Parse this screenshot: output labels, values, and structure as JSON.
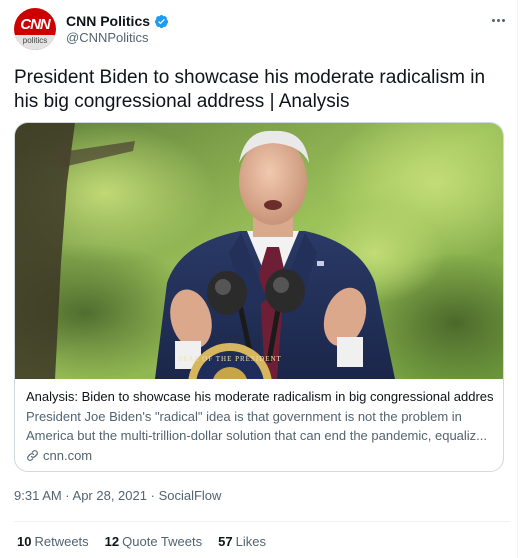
{
  "author": {
    "display_name": "CNN Politics",
    "handle": "@CNNPolitics",
    "avatar_logo": "CNN",
    "avatar_sub": "politics",
    "verified": true
  },
  "tweet": {
    "text": "President Biden to showcase his moderate radicalism in his big congressional address | Analysis",
    "timestamp": "9:31 AM · Apr 28, 2021",
    "source": "SocialFlow"
  },
  "card": {
    "title": "Analysis: Biden to showcase his moderate radicalism in big congressional address",
    "description": "President Joe Biden's \"radical\" idea is that government is not the problem in America but the multi-trillion-dollar solution that can end the pandemic, equaliz...",
    "domain": "cnn.com",
    "seal_text": "SEAL OF THE PRESIDENT"
  },
  "stats": {
    "retweets_count": "10",
    "retweets_label": "Retweets",
    "quotes_count": "12",
    "quotes_label": "Quote Tweets",
    "likes_count": "57",
    "likes_label": "Likes"
  },
  "colors": {
    "brand_red": "#cc0000",
    "verified_blue": "#1d9bf0",
    "secondary_text": "#536471"
  }
}
